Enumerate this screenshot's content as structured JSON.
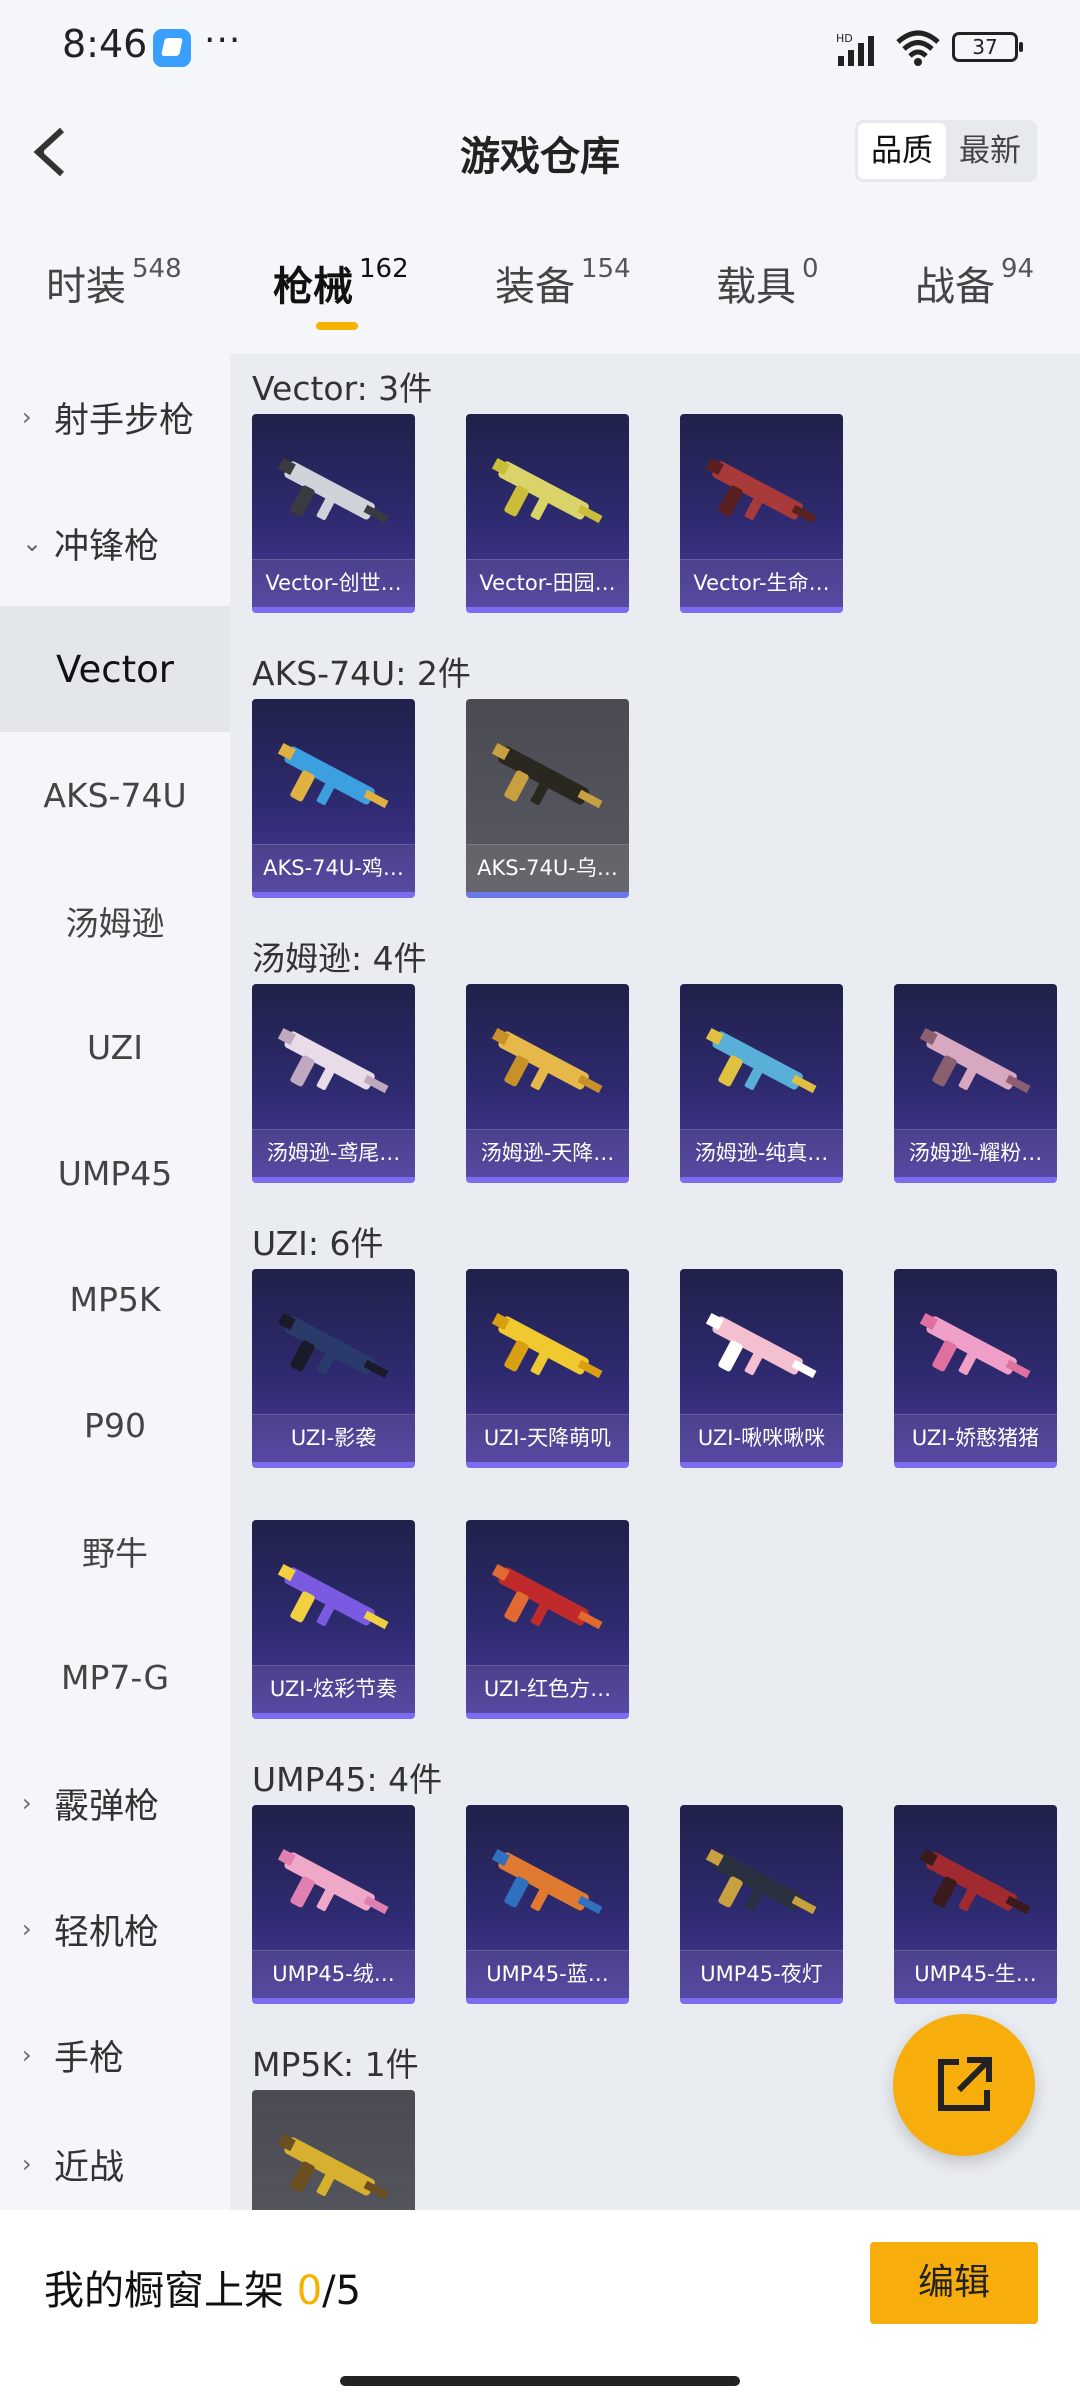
{
  "status": {
    "time": "8:46",
    "dots": "···",
    "battery": "37"
  },
  "header": {
    "title": "游戏仓库",
    "sort": [
      "品质",
      "最新"
    ]
  },
  "tabs": [
    {
      "label": "时装",
      "count": "548"
    },
    {
      "label": "枪械",
      "count": "162"
    },
    {
      "label": "装备",
      "count": "154"
    },
    {
      "label": "载具",
      "count": "0"
    },
    {
      "label": "战备",
      "count": "94"
    }
  ],
  "sidebar": [
    {
      "label": "射手步枪",
      "type": "group",
      "chevron": "›"
    },
    {
      "label": "冲锋枪",
      "type": "group",
      "chevron": "⌄"
    },
    {
      "label": "Vector",
      "type": "item"
    },
    {
      "label": "AKS-74U",
      "type": "item"
    },
    {
      "label": "汤姆逊",
      "type": "item"
    },
    {
      "label": "UZI",
      "type": "item"
    },
    {
      "label": "UMP45",
      "type": "item"
    },
    {
      "label": "MP5K",
      "type": "item"
    },
    {
      "label": "P90",
      "type": "item"
    },
    {
      "label": "野牛",
      "type": "item"
    },
    {
      "label": "MP7-G",
      "type": "item"
    },
    {
      "label": "霰弹枪",
      "type": "group",
      "chevron": "›"
    },
    {
      "label": "轻机枪",
      "type": "group",
      "chevron": "›"
    },
    {
      "label": "手枪",
      "type": "group",
      "chevron": "›"
    },
    {
      "label": "近战",
      "type": "group",
      "chevron": "›"
    }
  ],
  "sections": [
    {
      "title": "Vector: 3件",
      "items": [
        "Vector-创世…",
        "Vector-田园…",
        "Vector-生命…"
      ]
    },
    {
      "title": "AKS-74U: 2件",
      "items": [
        "AKS-74U-鸡…",
        "AKS-74U-乌…"
      ]
    },
    {
      "title": "汤姆逊: 4件",
      "items": [
        "汤姆逊-鸢尾…",
        "汤姆逊-天降…",
        "汤姆逊-纯真…",
        "汤姆逊-耀粉…"
      ]
    },
    {
      "title": "UZI: 6件",
      "items": [
        "UZI-影袭",
        "UZI-天降萌叽",
        "UZI-啾咪啾咪",
        "UZI-娇憨猪猪",
        "UZI-炫彩节奏",
        "UZI-红色方…"
      ]
    },
    {
      "title": "UMP45: 4件",
      "items": [
        "UMP45-绒…",
        "UMP45-蓝…",
        "UMP45-夜灯",
        "UMP45-生…"
      ]
    },
    {
      "title": "MP5K: 1件",
      "items": [
        ""
      ]
    }
  ],
  "bottom": {
    "prefix": "我的橱窗上架 ",
    "count": "0",
    "suffix": "/5",
    "edit": "编辑"
  },
  "icons": {
    "back": "back-chevron-icon",
    "share": "external-share-icon"
  },
  "colors": {
    "accent": "#f7ad0c",
    "card_purple": "#2e2a70"
  }
}
